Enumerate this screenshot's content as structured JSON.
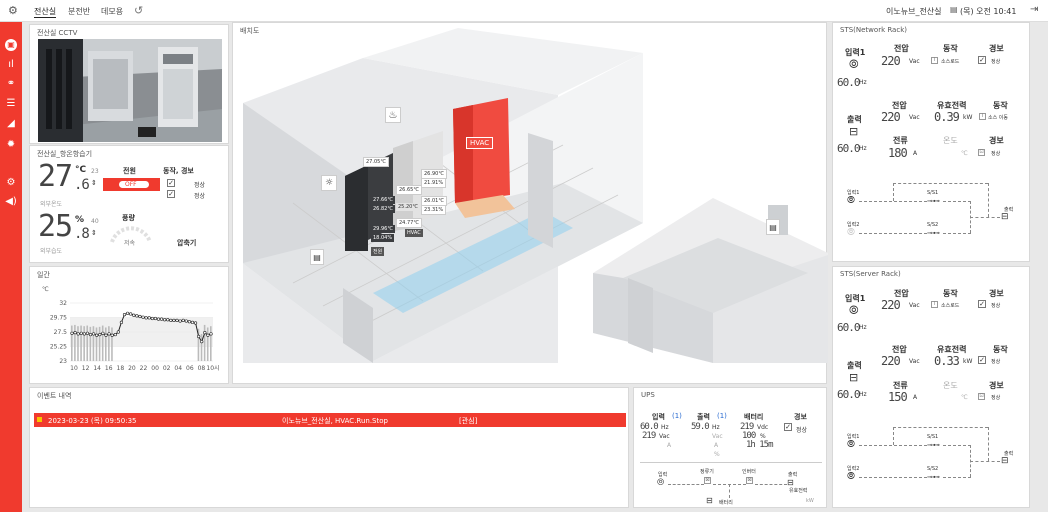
{
  "topbar": {
    "tabs": [
      "전산실",
      "분전반",
      "데모용"
    ],
    "location": "이노뉴브_전산실",
    "time": "(목) 오전 10:41"
  },
  "cctv": {
    "title": "전산실 CCTV"
  },
  "hvac": {
    "title": "전산실_항온항습기",
    "temp_int": "27",
    "temp_dec": ".6",
    "temp_unit": "°C",
    "temp_set": "23",
    "temp_label": "외부온도",
    "hum_int": "25",
    "hum_dec": ".8",
    "hum_unit": "%",
    "hum_set": "40",
    "hum_label": "외부습도",
    "power_label": "전원",
    "power_state": "OFF",
    "alarm_label": "동작, 경보",
    "ok1": "정상",
    "ok2": "정상",
    "wind_label": "풍량",
    "wind_value": "저속",
    "comp_label": "압축기"
  },
  "trend": {
    "title": "일간",
    "unit": "℃"
  },
  "chart_data": {
    "type": "line",
    "title": "",
    "ylabel": "℃",
    "ylim": [
      23,
      32
    ],
    "yticks": [
      "32",
      "29.75",
      "27.5",
      "25.25",
      "23"
    ],
    "x": [
      "10",
      "12",
      "14",
      "16",
      "18",
      "20",
      "22",
      "00",
      "02",
      "04",
      "06",
      "08",
      "10시"
    ],
    "series": [
      {
        "values": [
          27.3,
          27.4,
          27.2,
          27.3,
          27.2,
          27.3,
          27.1,
          27.2,
          27.0,
          27.1,
          27.3,
          27.0,
          27.2,
          27.0,
          27.1,
          27.5,
          29.0,
          30.2,
          30.4,
          30.3,
          30.1,
          30.0,
          29.9,
          29.8,
          29.7,
          29.7,
          29.6,
          29.6,
          29.5,
          29.5,
          29.4,
          29.4,
          29.3,
          29.3,
          29.3,
          29.2,
          29.3,
          29.2,
          29.1,
          29.0,
          28.9,
          26.8,
          26.0,
          27.4,
          27.0,
          27.2
        ]
      }
    ]
  },
  "layout": {
    "title": "배치도",
    "temps": [
      "27.05℃",
      "26.90℃",
      "21.91%",
      "26.65℃",
      "27.66℃",
      "26.82℃",
      "26.01℃",
      "23.31%",
      "25.20℃",
      "24.77℃",
      "29.96℃",
      "18.04%"
    ],
    "hvac_label": "HVAC",
    "rack_tag1": "전원",
    "rack_tag2": "HVAC"
  },
  "events": {
    "title": "이벤트 내역",
    "rows": [
      {
        "time": "2023-03-23 (목) 09:50:35",
        "msg": "이노뉴브_전산실, HVAC.Run.Stop",
        "tag": "[관심]"
      }
    ]
  },
  "ups": {
    "title": "UPS",
    "in_label": "입력",
    "in_n": "(1)",
    "out_label": "출력",
    "out_n": "(1)",
    "bat_label": "배터리",
    "alarm_label": "경보",
    "in_hz": "60.0",
    "in_hz_u": "Hz",
    "in_vac": "219",
    "in_vac_u": "Vac",
    "in_a_u": "A",
    "out_hz": "59.0",
    "out_hz_u": "Hz",
    "out_vac_u": "Vac",
    "out_a_u": "A",
    "out_pct_u": "%",
    "bat_v": "219",
    "bat_v_u": "Vdc",
    "bat_pct": "100",
    "bat_pct_u": "%",
    "bat_time": "1h 15m",
    "ok": "정상",
    "d_in": "입력",
    "d_rect": "정류기",
    "d_inv": "인버터",
    "d_out": "출력",
    "d_power": "유효전력",
    "d_kw": "kW",
    "d_bat": "배터리"
  },
  "sts_net": {
    "title": "STS(Network Rack)",
    "in1": "입력1",
    "hz1": "60.0",
    "hz_u": "Hz",
    "volt_label": "전압",
    "op_label": "동작",
    "alarm_label": "경보",
    "v1": "220",
    "v_u": "Vac",
    "op1": "소스로드",
    "ok1": "정상",
    "out_label": "출력",
    "v2": "220",
    "pw_label": "유효전력",
    "pw": "0.39",
    "pw_u": "kW",
    "op2": "소스 이동",
    "hz2": "60.0",
    "cur_label": "전류",
    "cur": "180",
    "cur_u": "A",
    "temp_label": "온도",
    "temp_u": "℃",
    "ok2": "정상",
    "d_in1": "입력1",
    "d_in2": "입력2",
    "d_s1": "S/S1",
    "d_s2": "S/S2",
    "d_out": "출력"
  },
  "sts_srv": {
    "title": "STS(Server Rack)",
    "in1": "입력1",
    "hz1": "60.0",
    "hz_u": "Hz",
    "volt_label": "전압",
    "op_label": "동작",
    "alarm_label": "경보",
    "v1": "220",
    "v_u": "Vac",
    "op1": "소스로드",
    "ok1": "정상",
    "out_label": "출력",
    "v2": "220",
    "pw_label": "유효전력",
    "pw": "0.33",
    "pw_u": "kW",
    "op2": "정상",
    "hz2": "60.0",
    "cur_label": "전류",
    "cur": "150",
    "cur_u": "A",
    "temp_label": "온도",
    "temp_u": "℃",
    "ok2": "정상",
    "d_in1": "입력1",
    "d_in2": "입력2",
    "d_s1": "S/S1",
    "d_s2": "S/S2",
    "d_out": "출력"
  }
}
